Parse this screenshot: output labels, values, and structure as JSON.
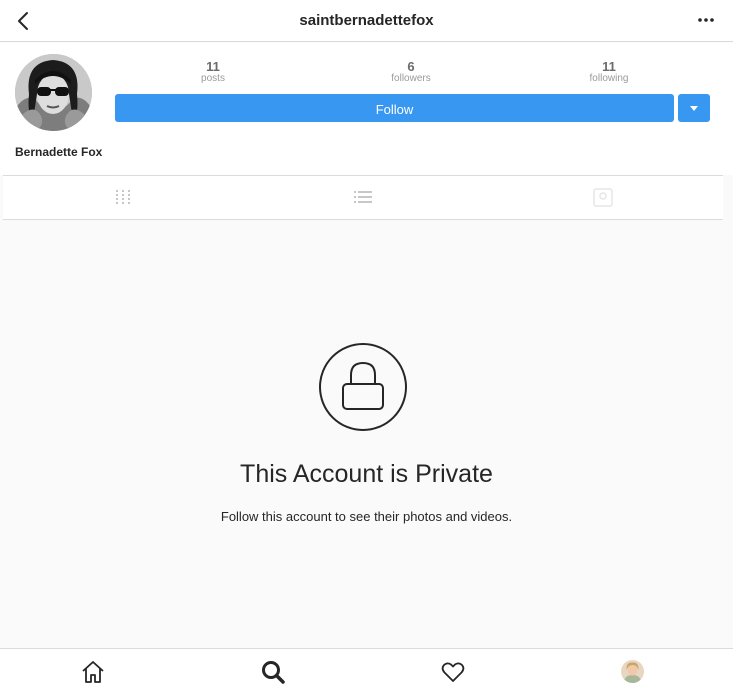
{
  "header": {
    "username": "saintbernadettefox",
    "back_icon": "chevron-left-icon",
    "more_icon": "ellipsis-icon"
  },
  "profile": {
    "full_name": "Bernadette Fox",
    "stats": {
      "posts_count": "11",
      "posts_label": "posts",
      "followers_count": "6",
      "followers_label": "followers",
      "following_count": "11",
      "following_label": "following"
    },
    "follow_label": "Follow",
    "accent_color": "#3897f0"
  },
  "tabs": [
    {
      "icon": "grid-icon"
    },
    {
      "icon": "list-icon"
    },
    {
      "icon": "tagged-icon"
    }
  ],
  "private_notice": {
    "title": "This Account is Private",
    "subtitle": "Follow this account to see their photos and videos.",
    "icon": "lock-icon"
  },
  "bottom_nav": [
    {
      "icon": "home-icon"
    },
    {
      "icon": "search-icon"
    },
    {
      "icon": "heart-icon"
    },
    {
      "icon": "profile-avatar"
    }
  ]
}
